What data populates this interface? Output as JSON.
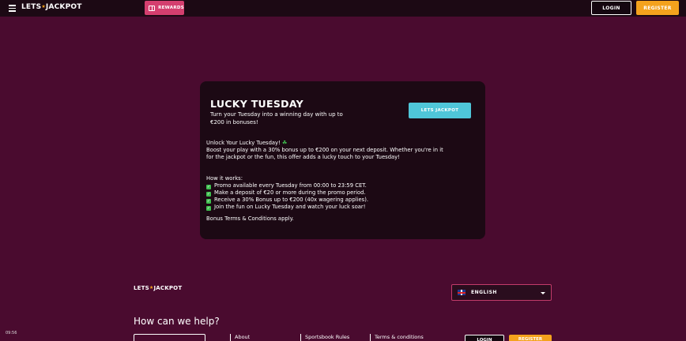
{
  "header": {
    "logo_left": "LETS",
    "logo_star": "★",
    "logo_right": "JACKPOT",
    "rewards_label": "REWARDS",
    "login_label": "LOGIN",
    "register_label": "REGISTER"
  },
  "promo": {
    "title": "LUCKY TUESDAY",
    "subtitle": "Turn your Tuesday into a winning day with up to €200 in bonuses!",
    "cta_label": "LETS JACKPOT",
    "intro_heading": "Unlock Your Lucky Tuesday!",
    "clover": "☘",
    "intro_text": "Boost your play with a 30% bonus up to €200 on your next deposit. Whether you're in it for the jackpot or the fun, this offer adds a lucky touch to your Tuesday!",
    "how_heading": "How it works:",
    "check_mark": "✓",
    "steps": [
      "Promo available every Tuesday from 00:00 to 23:59 CET.",
      "Make a deposit of €20 or more during the promo period.",
      "Receive a 30% Bonus up to €200 (40x wagering applies).",
      "Join the fun on Lucky Tuesday and watch your luck soar!"
    ],
    "terms": "Bonus Terms & Conditions apply."
  },
  "footer": {
    "logo_left": "LETS",
    "logo_star": "★",
    "logo_right": "JACKPOT",
    "language": "ENGLISH",
    "help_title": "How can we help?",
    "time": "09:56",
    "links": [
      "About",
      "Sportsbook Rules",
      "Terms & conditions"
    ],
    "login_label": "LOGIN",
    "register_label": "REGISTER"
  },
  "colors": {
    "background": "#4a0b2f",
    "header": "#1c0914",
    "accent_orange": "#f4a21d",
    "accent_pink": "#d43f6f",
    "accent_cyan": "#4fc6d9"
  }
}
